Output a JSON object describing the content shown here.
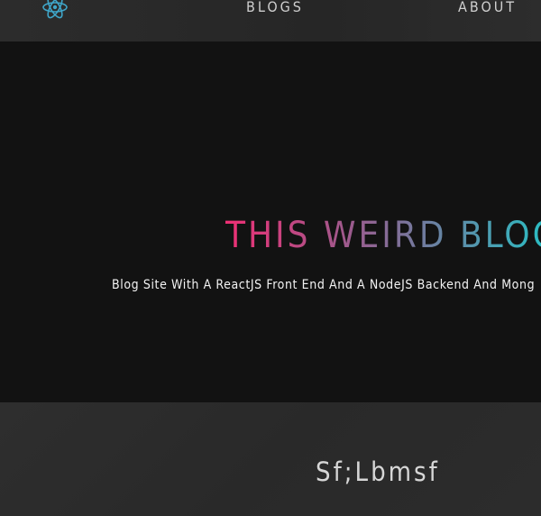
{
  "nav": {
    "logo_icon": "react-atom-icon",
    "links": [
      {
        "label": "BLOGS"
      },
      {
        "label": "ABOUT"
      }
    ],
    "accent_color": "#3fa6c9"
  },
  "hero": {
    "title": "THIS WEIRD BLOG",
    "subtitle": "Blog Site With A ReactJS Front End And A NodeJS Backend And Mong",
    "title_gradient": [
      "#ee2f74",
      "#9a5c8e",
      "#6585a4",
      "#22c6c8"
    ]
  },
  "posts": {
    "title": "Sf;Lbmsf"
  }
}
